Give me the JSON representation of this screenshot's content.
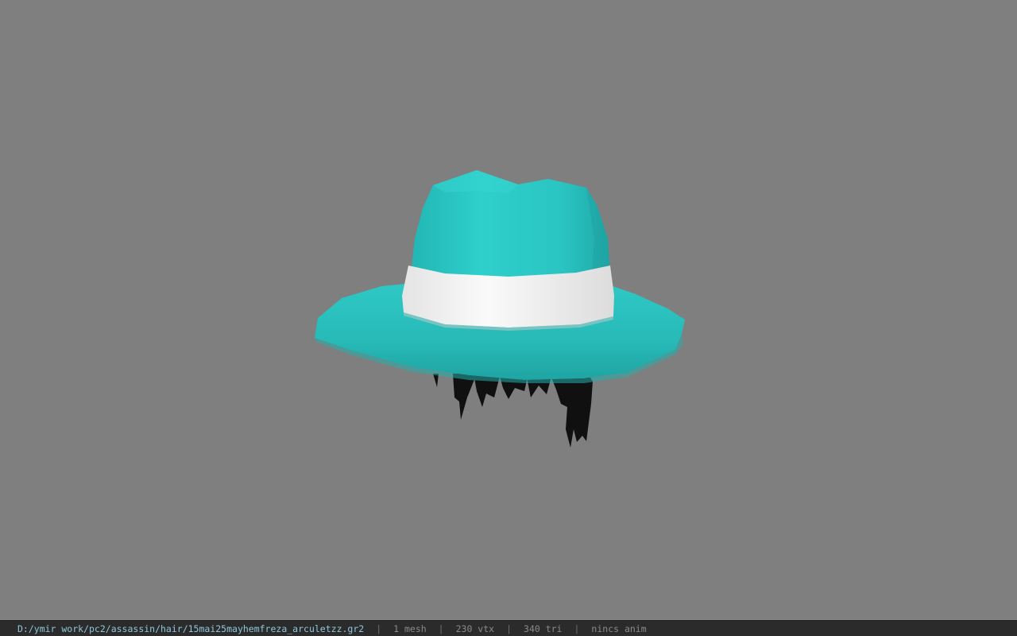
{
  "viewer": {
    "background_color": "#7f7f7f",
    "model": {
      "name": "15mai25mayhemfreza_arculetzz",
      "hat_color": "#2ec9c6",
      "band_color": "#f2f2f2",
      "hair_color": "#111111"
    }
  },
  "statusbar": {
    "file_path": "D:/ymir work/pc2/assassin/hair/15mai25mayhemfreza_arculetzz.gr2",
    "separator": "|",
    "mesh_count": "1 mesh",
    "vertex_count": "230 vtx",
    "triangle_count": "340 tri",
    "anim_status": "nincs anim"
  }
}
